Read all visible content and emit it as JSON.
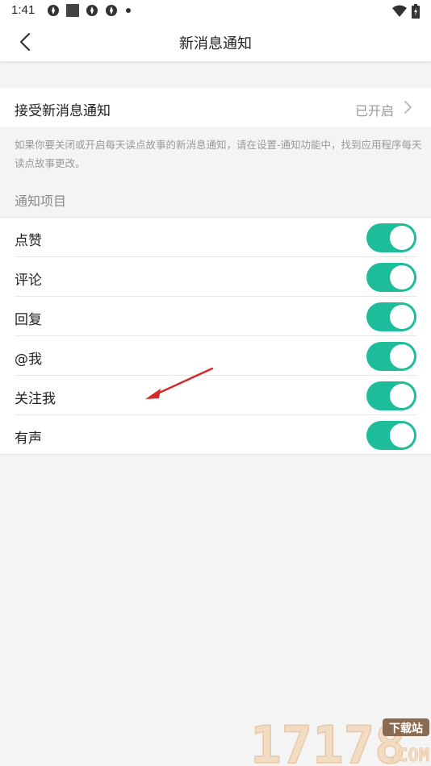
{
  "status_bar": {
    "time": "1:41",
    "left_icons": [
      "app-notification-icon",
      "stop-square-icon",
      "app-notification-icon",
      "app-notification-icon",
      "more-dot-icon"
    ],
    "right_icons": [
      "wifi-icon",
      "battery-icon"
    ]
  },
  "header": {
    "title": "新消息通知",
    "back_icon": "chevron-left-icon"
  },
  "receive": {
    "label": "接受新消息通知",
    "value": "已开启",
    "chevron_icon": "chevron-right-icon"
  },
  "hint": "如果你要关闭或开启每天读点故事的新消息通知，请在设置-通知功能中，找到应用程序每天读点故事更改。",
  "section_title": "通知项目",
  "items": [
    {
      "label": "点赞",
      "enabled": true
    },
    {
      "label": "评论",
      "enabled": true
    },
    {
      "label": "回复",
      "enabled": true
    },
    {
      "label": "@我",
      "enabled": true
    },
    {
      "label": "关注我",
      "enabled": true
    },
    {
      "label": "有声",
      "enabled": true
    }
  ],
  "watermark": {
    "text": "17178",
    "tag": "下载站",
    "domain": ".COM"
  },
  "colors": {
    "accent": "#1dbd9c",
    "background": "#f4f4f4",
    "surface": "#ffffff",
    "annotation_arrow": "#d42a2a"
  }
}
